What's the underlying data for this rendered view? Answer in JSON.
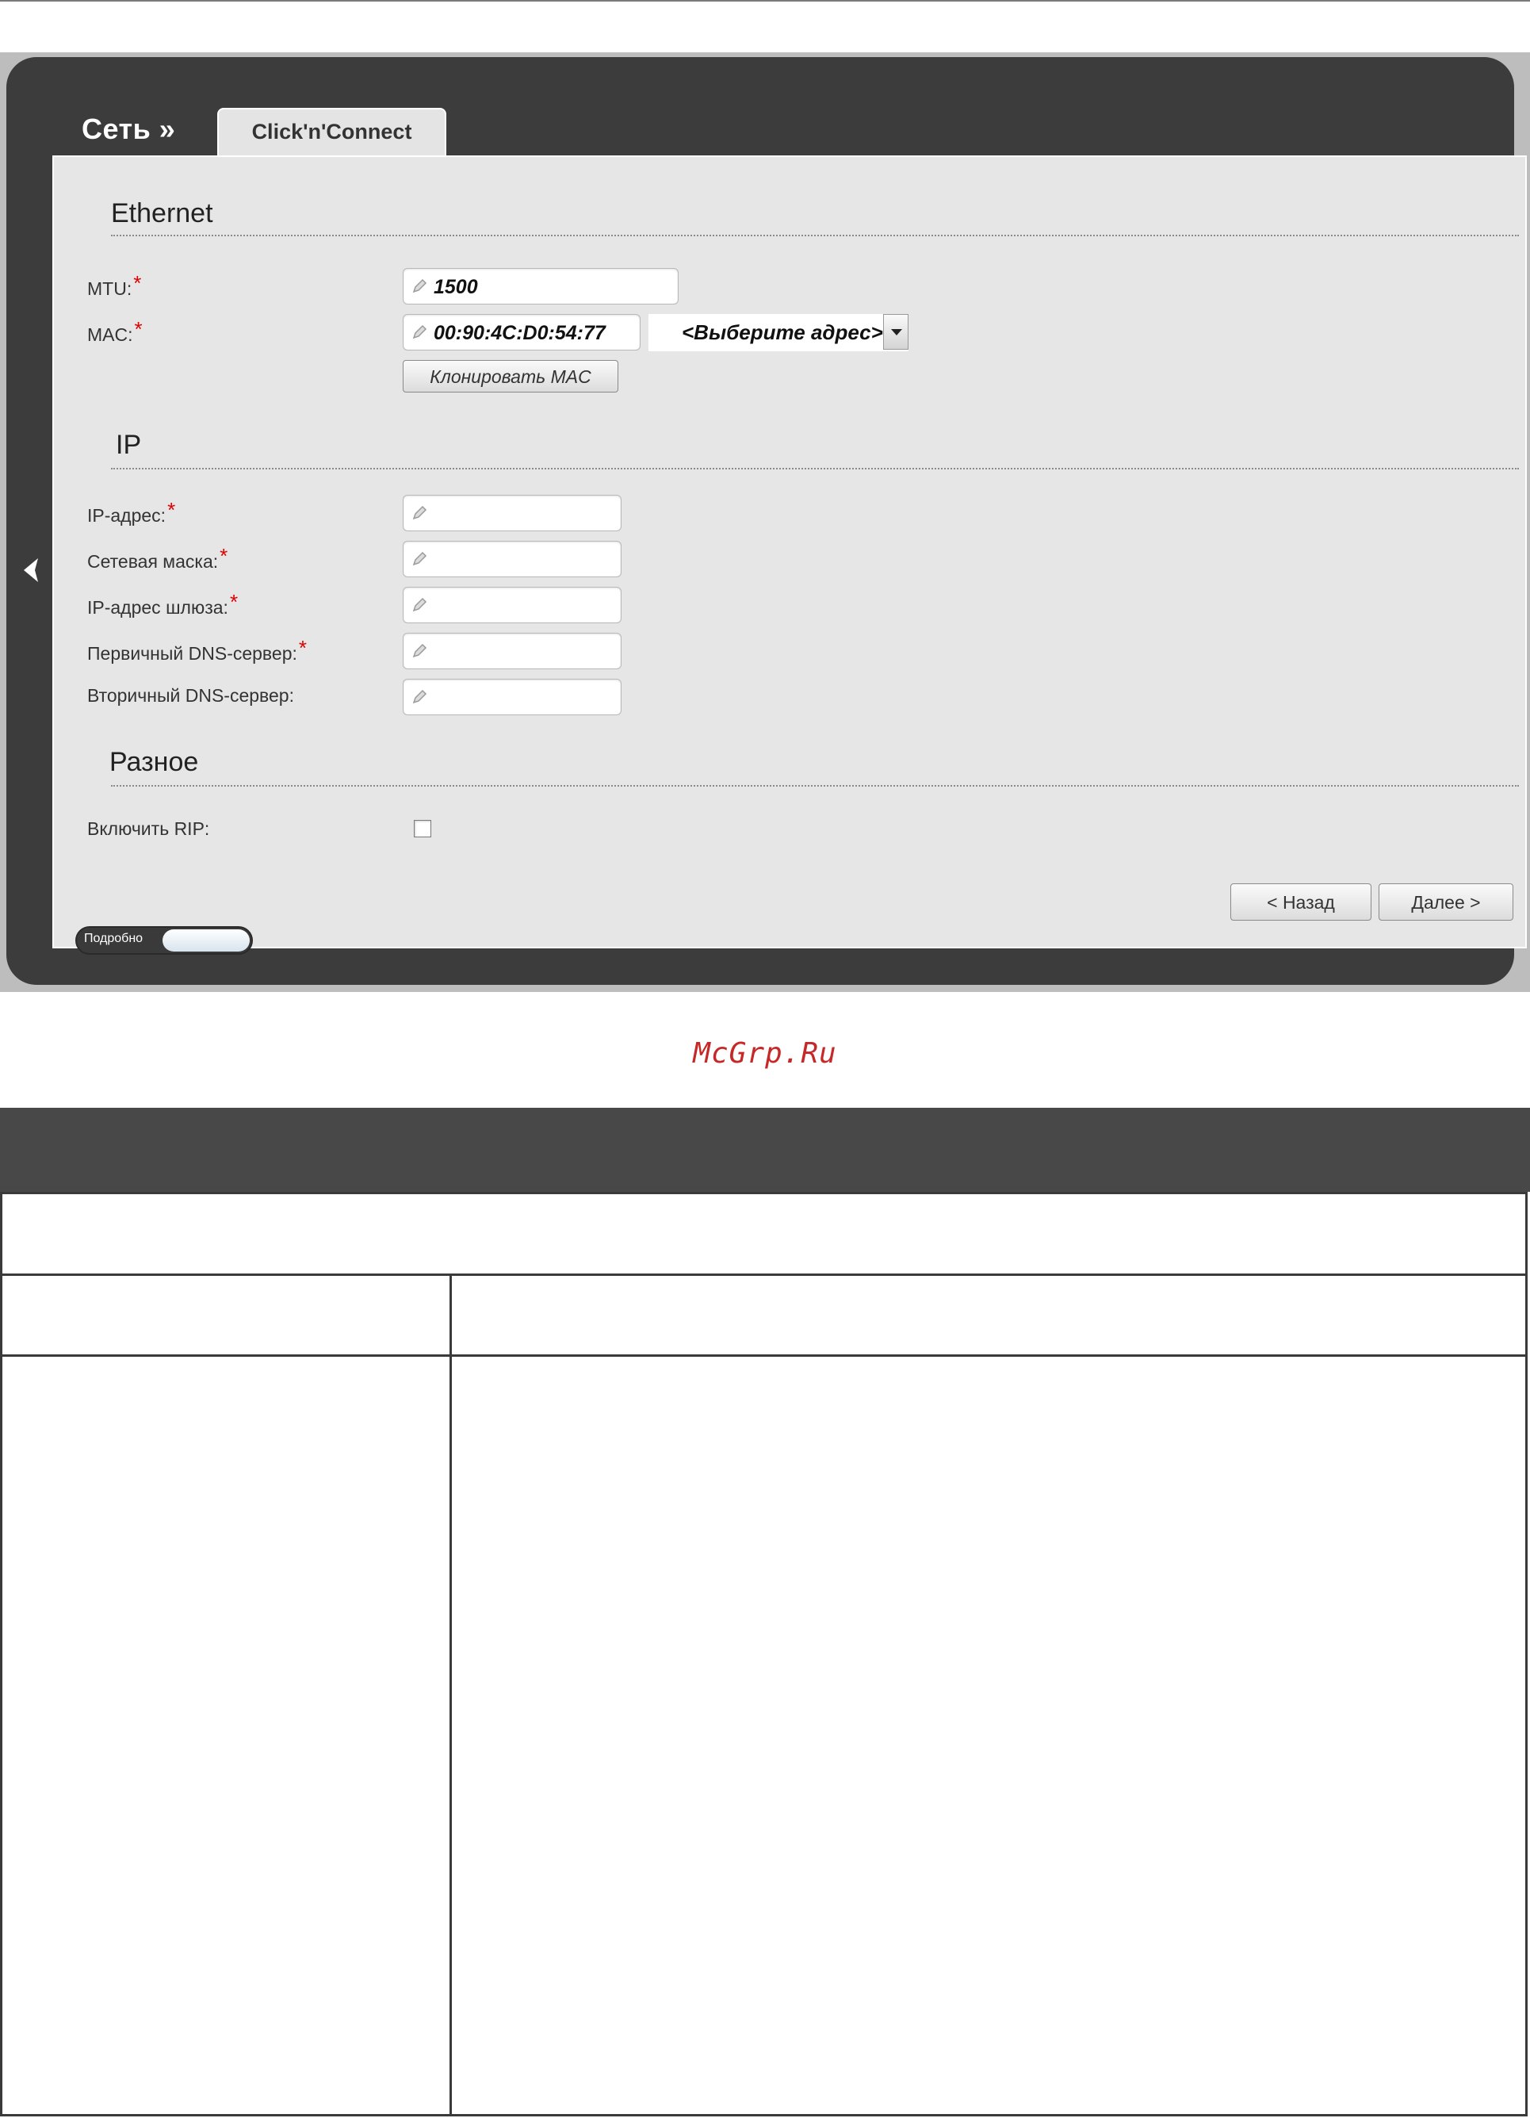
{
  "breadcrumb": "Сеть »",
  "tab_label": "Click'n'Connect",
  "sections": {
    "ethernet": "Ethernet",
    "ip": "IP",
    "misc": "Разное"
  },
  "fields": {
    "mtu": {
      "label": "MTU:",
      "value": "1500",
      "required": "*"
    },
    "mac": {
      "label": "MAC:",
      "value": "00:90:4C:D0:54:77",
      "required": "*"
    },
    "mac_select": "<Выберите адрес>",
    "clone_mac_button": "Клонировать MAC",
    "ip_address": {
      "label": "IP-адрес:",
      "value": "",
      "required": "*"
    },
    "netmask": {
      "label": "Сетевая маска:",
      "value": "",
      "required": "*"
    },
    "gateway": {
      "label": "IP-адрес шлюза:",
      "value": "",
      "required": "*"
    },
    "dns1": {
      "label": "Первичный DNS-сервер:",
      "value": "",
      "required": "*"
    },
    "dns2": {
      "label": "Вторичный DNS-сервер:",
      "value": ""
    },
    "rip": {
      "label": "Включить RIP:",
      "checked": false
    }
  },
  "details_toggle": "Подробно",
  "buttons": {
    "back": "< Назад",
    "next": "Далее >"
  },
  "watermark": "McGrp.Ru",
  "colors": {
    "frame_dark": "#3c3c3c",
    "panel": "#e6e6e6",
    "required": "#e00000",
    "watermark": "#c62828",
    "table_header": "#484848"
  }
}
